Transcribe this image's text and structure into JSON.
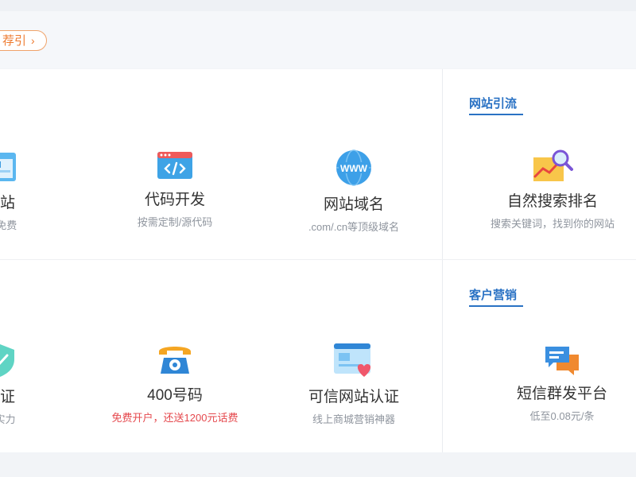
{
  "top_pill": {
    "label": "荐引",
    "chevron": "›"
  },
  "products": [
    {
      "icon": "website-builder-icon",
      "title": "建站",
      "sub": "板/免费"
    },
    {
      "icon": "code-icon",
      "title": "代码开发",
      "sub": "按需定制/源代码"
    },
    {
      "icon": "www-globe-icon",
      "title": "网站域名",
      "sub": ".com/.cn等顶级域名"
    },
    {
      "icon": "shield-icon",
      "title": "认证",
      "sub": "业实力"
    },
    {
      "icon": "telephone-icon",
      "title": "400号码",
      "sub": "免费开户，还送1200元话费"
    },
    {
      "icon": "trusted-site-icon",
      "title": "可信网站认证",
      "sub": "线上商城营销神器"
    }
  ],
  "sections": [
    {
      "heading": "网站引流",
      "item": {
        "icon": "search-chart-icon",
        "title": "自然搜索排名",
        "sub": "搜索关键词，找到你的网站"
      }
    },
    {
      "heading": "客户营销",
      "item": {
        "icon": "sms-icon",
        "title": "短信群发平台",
        "sub": "低至0.08元/条"
      }
    }
  ],
  "colors": {
    "accent": "#2a72c4",
    "orange": "#ee7a2f",
    "red": "#e5484d"
  }
}
